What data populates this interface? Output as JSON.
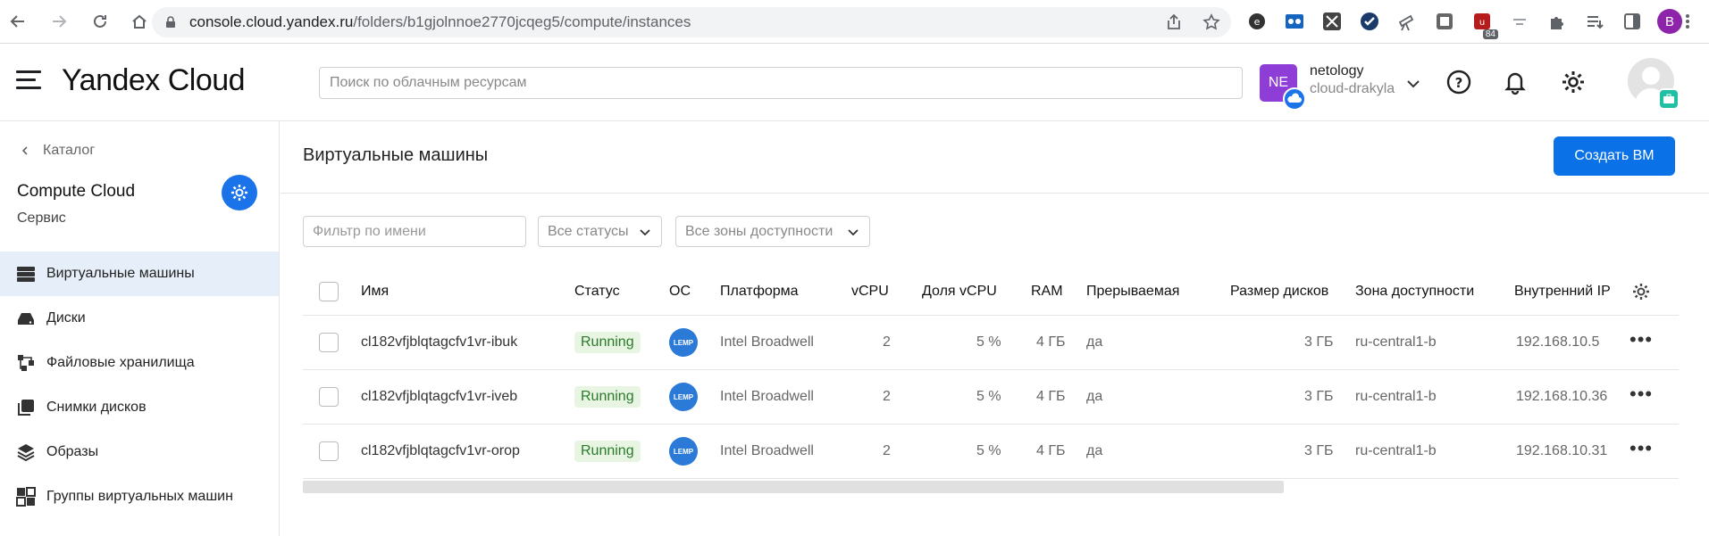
{
  "browser": {
    "url_host": "console.cloud.yandex.ru",
    "url_path": "/folders/b1gjolnnoe2770jcqeg5/compute/instances",
    "ext_badge": "84",
    "profile_letter": "B"
  },
  "header": {
    "logo": "Yandex Cloud",
    "search_placeholder": "Поиск по облачным ресурсам",
    "cloud_initials": "NE",
    "org_name": "netology",
    "cloud_name": "cloud-drakyla"
  },
  "sidebar": {
    "back_label": "Каталог",
    "service_title": "Compute Cloud",
    "service_subtitle": "Сервис",
    "items": [
      {
        "label": "Виртуальные машины",
        "icon": "server-icon",
        "active": true
      },
      {
        "label": "Диски",
        "icon": "disk-icon",
        "active": false
      },
      {
        "label": "Файловые хранилища",
        "icon": "file-storage-icon",
        "active": false
      },
      {
        "label": "Снимки дисков",
        "icon": "snapshot-icon",
        "active": false
      },
      {
        "label": "Образы",
        "icon": "layers-icon",
        "active": false
      },
      {
        "label": "Группы виртуальных машин",
        "icon": "instance-group-icon",
        "active": false
      }
    ]
  },
  "main": {
    "title": "Виртуальные машины",
    "create_button": "Создать ВМ",
    "filter_placeholder": "Фильтр по имени",
    "status_filter": "Все статусы",
    "zone_filter": "Все зоны доступности"
  },
  "table": {
    "columns": [
      "Имя",
      "Статус",
      "ОС",
      "Платформа",
      "vCPU",
      "Доля vCPU",
      "RAM",
      "Прерываемая",
      "Размер дисков",
      "Зона доступности",
      "Внутренний IP"
    ],
    "rows": [
      {
        "name": "cl182vfjblqtagcfv1vr-ibuk",
        "status": "Running",
        "os": "LEMP",
        "platform": "Intel Broadwell",
        "vcpu": "2",
        "share": "5 %",
        "ram": "4 ГБ",
        "preemptible": "да",
        "disk": "3 ГБ",
        "zone": "ru-central1-b",
        "ip": "192.168.10.5"
      },
      {
        "name": "cl182vfjblqtagcfv1vr-iveb",
        "status": "Running",
        "os": "LEMP",
        "platform": "Intel Broadwell",
        "vcpu": "2",
        "share": "5 %",
        "ram": "4 ГБ",
        "preemptible": "да",
        "disk": "3 ГБ",
        "zone": "ru-central1-b",
        "ip": "192.168.10.36"
      },
      {
        "name": "cl182vfjblqtagcfv1vr-orop",
        "status": "Running",
        "os": "LEMP",
        "platform": "Intel Broadwell",
        "vcpu": "2",
        "share": "5 %",
        "ram": "4 ГБ",
        "preemptible": "да",
        "disk": "3 ГБ",
        "zone": "ru-central1-b",
        "ip": "192.168.10.31"
      }
    ]
  },
  "colors": {
    "accent": "#0a72e6",
    "status_running_bg": "#e8f5e3",
    "cloud_avatar": "#8e3ed6"
  }
}
